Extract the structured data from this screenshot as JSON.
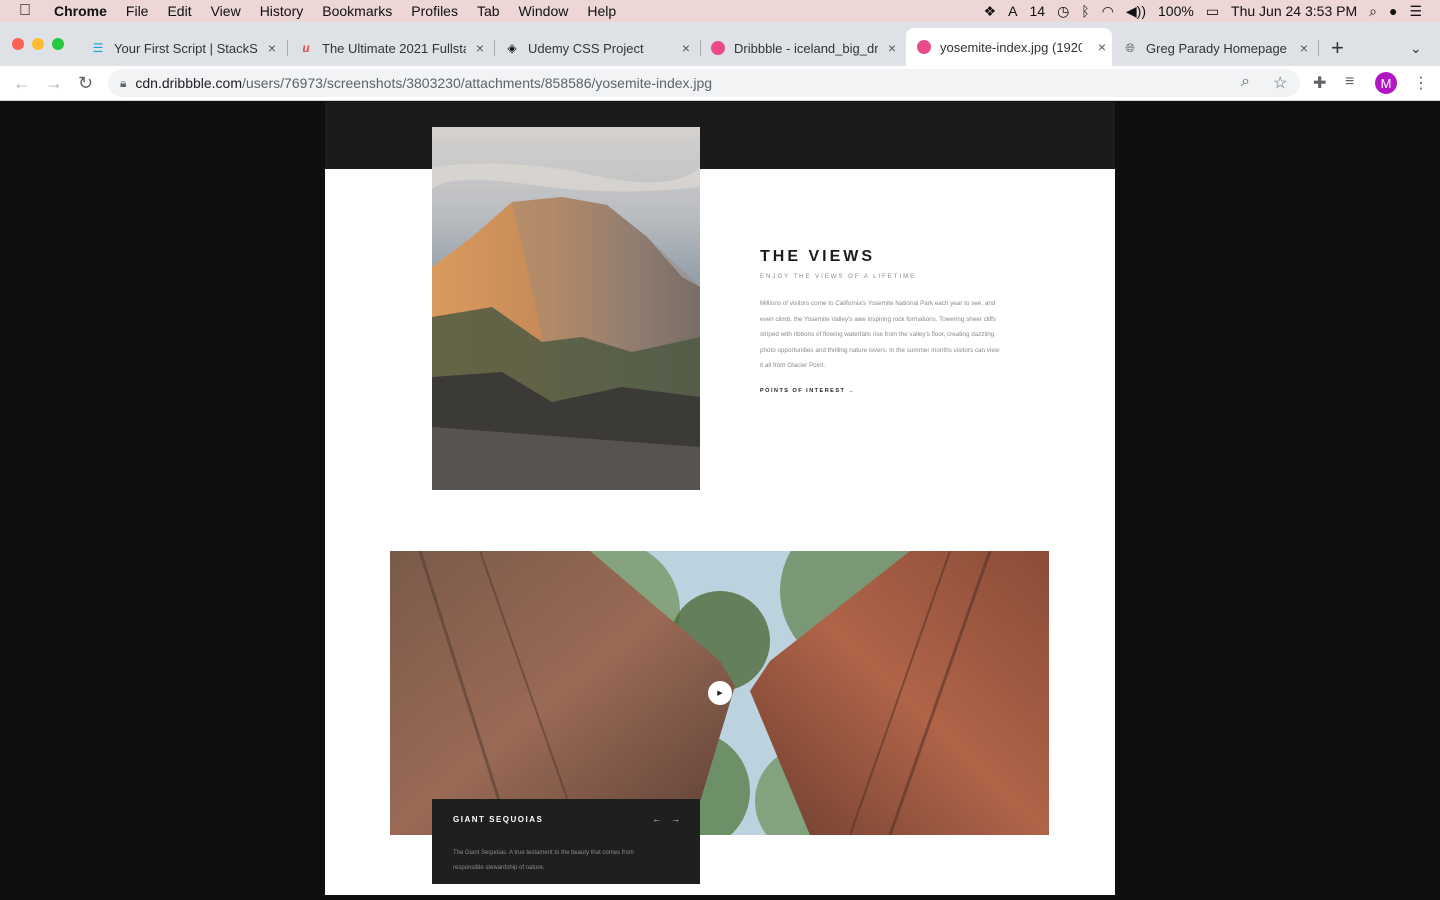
{
  "menubar": {
    "app": "Chrome",
    "items": [
      "File",
      "Edit",
      "View",
      "History",
      "Bookmarks",
      "Profiles",
      "Tab",
      "Window",
      "Help"
    ],
    "status": {
      "notifications": "14",
      "battery": "100%",
      "datetime": "Thu Jun 24  3:53 PM"
    }
  },
  "tabs": [
    {
      "title": "Your First Script | StackS",
      "icon": "stacks-icon",
      "color": "#1ba1e2"
    },
    {
      "title": "The Ultimate 2021 Fullsta",
      "icon": "udemy-icon",
      "color": "#e8474c"
    },
    {
      "title": "Udemy CSS Project",
      "icon": "codepen-icon",
      "color": "#111111"
    },
    {
      "title": "Dribbble - iceland_big_dr",
      "icon": "dribbble-icon",
      "color": "#ea4c89"
    },
    {
      "title": "yosemite-index.jpg (1920",
      "icon": "dribbble-icon",
      "color": "#ea4c89",
      "active": true
    },
    {
      "title": "Greg Parady Homepage",
      "icon": "globe-icon",
      "color": "#5f6368"
    }
  ],
  "address": {
    "host": "cdn.dribbble.com",
    "path": "/users/76973/screenshots/3803230/attachments/858586/yosemite-index.jpg"
  },
  "profile": {
    "initial": "M"
  },
  "content": {
    "views_title": "THE VIEWS",
    "views_subtitle": "ENJOY THE VIEWS OF A LIFETIME",
    "views_body": "Millions of visitors come to California's Yosemite National Park each year to see, and even climb, the Yosemite Valley's awe inspiring rock formations. Towering sheer cliffs striped with ribbons of flowing waterfalls rise from the valley's floor, creating dazzling photo opportunities and thrilling nature lovers. In the summer months visitors can view it all from Glacier Point.",
    "views_link": "POINTS OF INTEREST  →",
    "card_title": "GIANT SEQUOIAS",
    "card_prev": "←",
    "card_next": "→",
    "card_desc": "The Giant Sequoias. A true testament to the beauty that comes from responsible stewardship of nature."
  }
}
